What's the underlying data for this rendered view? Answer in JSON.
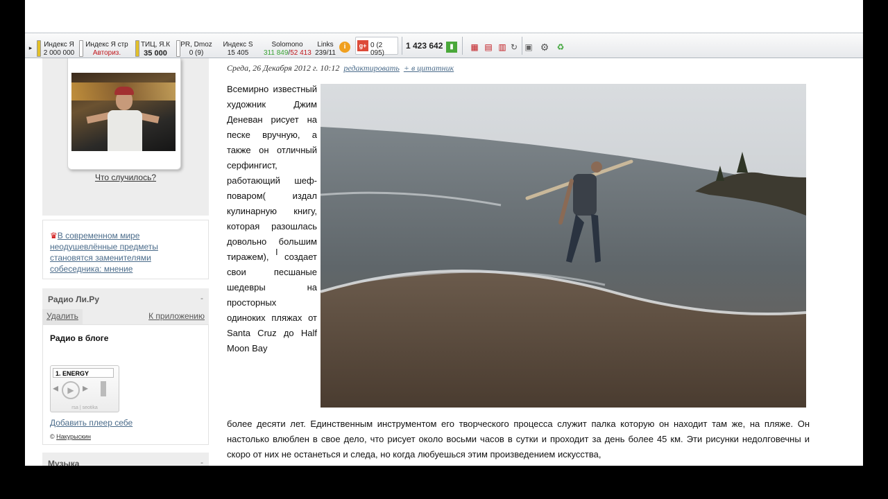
{
  "toolbar": {
    "yandex_index": {
      "label": "Индекс Я",
      "value": "2 000 000"
    },
    "yandex_pages": {
      "label": "Индекс Я стр",
      "value": "Авториз."
    },
    "tic": {
      "label": "ТИЦ, Я.К",
      "value": "35 000"
    },
    "pr": {
      "label": "PR, Dmoz",
      "value": "0 (9)"
    },
    "index_s": {
      "label": "Индекс S",
      "value": "15 405"
    },
    "solomono": {
      "label": "Solomono",
      "value_a": "311 849",
      "value_b": "52 413"
    },
    "links": {
      "label": "Links",
      "value": "239/11"
    },
    "gplus": {
      "value": "0 (2 095)"
    },
    "counter": {
      "value": "1 423 642"
    },
    "colors": {
      "accent_green": "#3aa335",
      "accent_red": "#c0161b",
      "bar_yellow": "#e2c02a"
    }
  },
  "sidebar": {
    "status_link": "Что случилось?",
    "news_link": "В современном мире неодушевлённые предметы становятся заменителями собеседника: мнение",
    "radio": {
      "header": "Радио Ли.Ру",
      "collapse": "-",
      "tab_delete": "Удалить",
      "tab_app": "К приложению",
      "title": "Радио в блоге",
      "station": "1. ENERGY",
      "player_footer": "rsa | seotika",
      "add_player": "Добавить плеер себе",
      "copyright_symbol": "©",
      "copyright_author": "Накурыскин"
    },
    "music": {
      "header": "Музыка",
      "collapse": "-"
    }
  },
  "post": {
    "date": "Среда, 26 Декабря 2012 г. 10:12",
    "edit_link": "редактировать",
    "quote_link": "+ в цитатник",
    "text_column": "Всемирно известный художник Джим Деневан рисует на песке вручную, а также он отличный серфингист, работающий шеф-поваром( издал кулинарную книгу, которая разошлась довольно большим тиражем), создает свои песшаные шедевры на просторных одиноких пляжах от Santa Cruz до Half Moon Bay",
    "text_full": "более десяти лет. Единственным инструментом его творческого процесса служит палка которую он находит там же, на пляже. Он настолько влюблен в свое дело, что  рисует  около восьми часов в сутки и проходит за день более 45 км. Эти рисунки недолговечны и скоро от них не останеться и следа, но когда любуешься этим произведением искусства,"
  }
}
